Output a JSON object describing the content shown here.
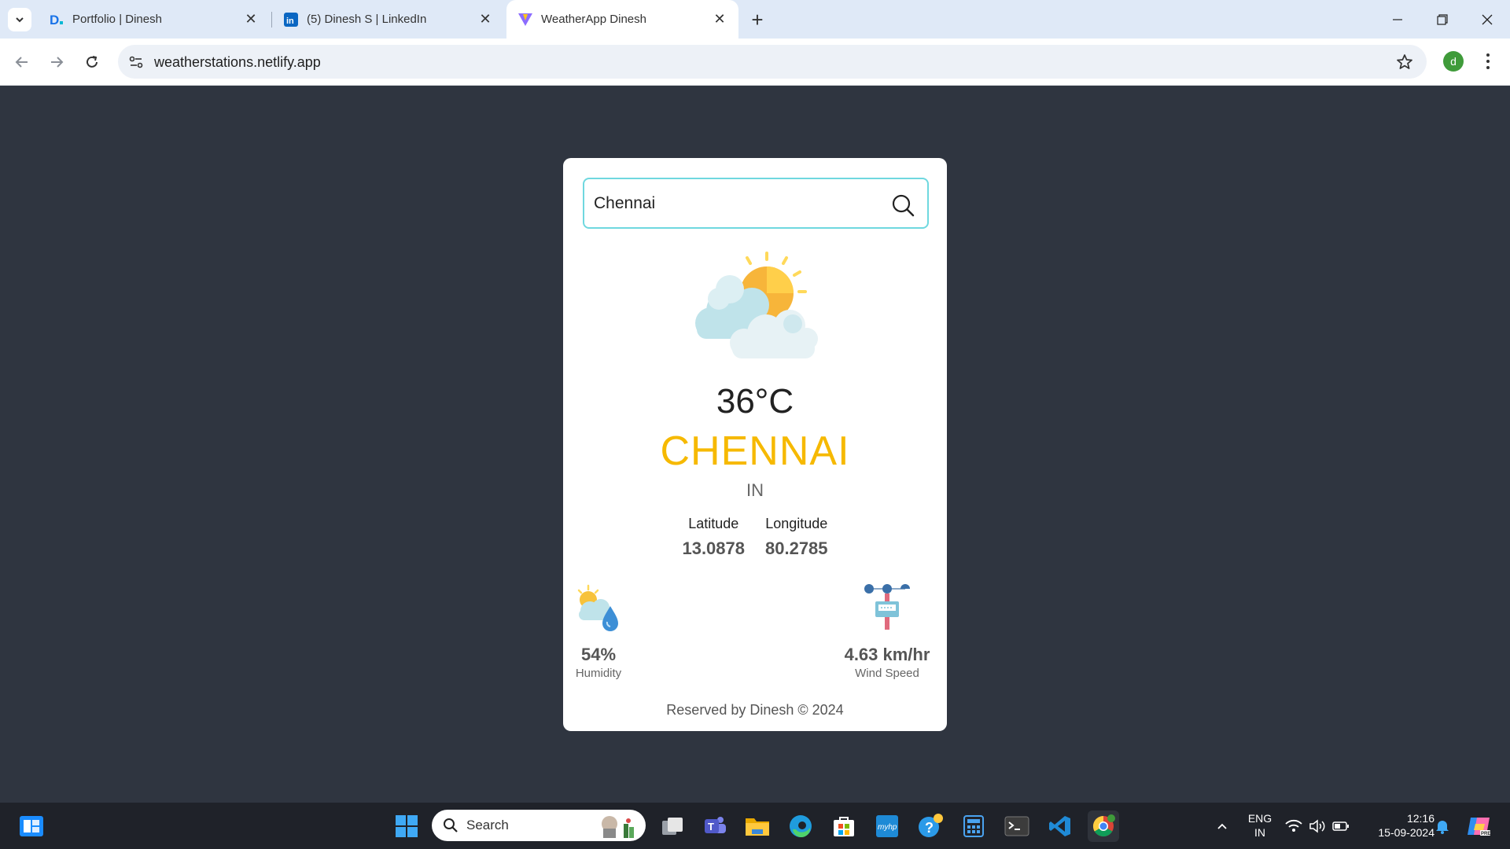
{
  "browser": {
    "tabs": [
      {
        "title": "Portfolio | Dinesh",
        "favicon": "portfolio-favicon",
        "active": false
      },
      {
        "title": "(5) Dinesh S | LinkedIn",
        "favicon": "linkedin-favicon",
        "active": false
      },
      {
        "title": "WeatherApp Dinesh",
        "favicon": "vite-favicon",
        "active": true
      }
    ],
    "url": "weatherstations.netlify.app",
    "profile_initial": "d",
    "accent": "#dfe9f7"
  },
  "weather": {
    "search_value": "Chennai",
    "temperature": "36°C",
    "city": "CHENNAI",
    "country": "IN",
    "latitude_label": "Latitude",
    "latitude": "13.0878",
    "longitude_label": "Longitude",
    "longitude": "80.2785",
    "humidity": "54%",
    "humidity_label": "Humidity",
    "wind": "4.63 km/hr",
    "wind_label": "Wind Speed",
    "footer": "Reserved by Dinesh © 2024",
    "city_color": "#f6b900",
    "search_border_color": "#6fd8df"
  },
  "taskbar": {
    "search_label": "Search",
    "lang_line1": "ENG",
    "lang_line2": "IN",
    "time": "12:16",
    "date": "15-09-2024"
  }
}
